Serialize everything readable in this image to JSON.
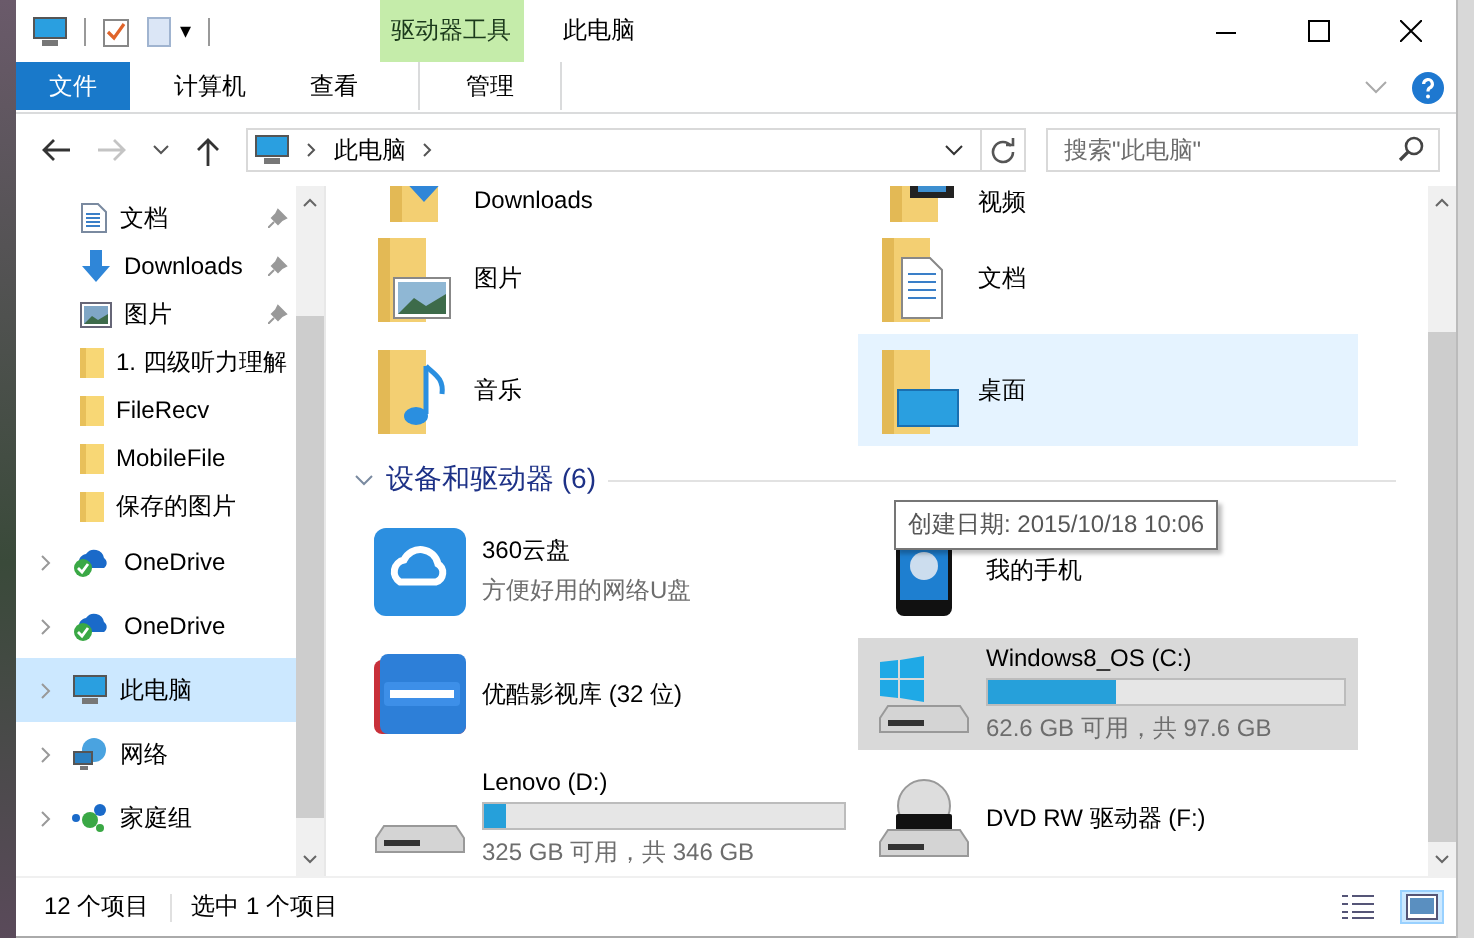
{
  "quick_access_toolbar": {
    "dropdown": "▾"
  },
  "window": {
    "title": "此电脑",
    "context_tab_group": "驱动器工具"
  },
  "ribbon_tabs": [
    {
      "label": "文件",
      "kind": "file",
      "selected": false
    },
    {
      "label": "计算机",
      "kind": "tab",
      "selected": false
    },
    {
      "label": "查看",
      "kind": "tab",
      "selected": false
    },
    {
      "label": "管理",
      "kind": "context",
      "selected": false
    }
  ],
  "address_bar": {
    "path": [
      "此电脑"
    ],
    "forward_disabled": true
  },
  "search": {
    "placeholder": "搜索\"此电脑\""
  },
  "navigation": {
    "items": [
      {
        "label": "文档",
        "pinned": true,
        "expandable": false,
        "selected": false
      },
      {
        "label": "Downloads",
        "pinned": true,
        "expandable": false,
        "selected": false
      },
      {
        "label": "图片",
        "pinned": true,
        "expandable": false,
        "selected": false
      },
      {
        "label": "1. 四级听力理解",
        "pinned": false,
        "expandable": false,
        "selected": false
      },
      {
        "label": "FileRecv",
        "pinned": false,
        "expandable": false,
        "selected": false
      },
      {
        "label": "MobileFile",
        "pinned": false,
        "expandable": false,
        "selected": false
      },
      {
        "label": "保存的图片",
        "pinned": false,
        "expandable": false,
        "selected": false
      },
      {
        "label": "OneDrive",
        "pinned": false,
        "expandable": true,
        "selected": false
      },
      {
        "label": "OneDrive",
        "pinned": false,
        "expandable": true,
        "selected": false
      },
      {
        "label": "此电脑",
        "pinned": false,
        "expandable": true,
        "selected": true
      },
      {
        "label": "网络",
        "pinned": false,
        "expandable": true,
        "selected": false
      },
      {
        "label": "家庭组",
        "pinned": false,
        "expandable": true,
        "selected": false
      }
    ]
  },
  "folders": [
    {
      "name": "Downloads",
      "hovered": false
    },
    {
      "name": "视频",
      "hovered": false
    },
    {
      "name": "图片",
      "hovered": false
    },
    {
      "name": "文档",
      "hovered": false
    },
    {
      "name": "音乐",
      "hovered": false
    },
    {
      "name": "桌面",
      "hovered": true
    }
  ],
  "devices_group": {
    "title": "设备和驱动器 (6)",
    "expanded": true,
    "items": [
      {
        "kind": "app",
        "name": "360云盘",
        "subtitle": "方便好用的网络U盘",
        "selected": false
      },
      {
        "kind": "device",
        "name": "我的手机",
        "selected": false
      },
      {
        "kind": "app",
        "name": "优酷影视库 (32 位)",
        "selected": false
      },
      {
        "kind": "drive",
        "name": "Windows8_OS (C:)",
        "level": 0.36,
        "space": "62.6 GB 可用，共 97.6 GB",
        "selected": true
      },
      {
        "kind": "drive",
        "name": "Lenovo (D:)",
        "level": 0.06,
        "space": "325 GB 可用，共 346 GB",
        "selected": false
      },
      {
        "kind": "optical",
        "name": "DVD RW 驱动器 (F:)",
        "selected": false
      }
    ]
  },
  "tooltip": {
    "text": "创建日期: 2015/10/18 10:06"
  },
  "status_bar": {
    "item_count": "12 个项目",
    "selection": "选中 1 个项目",
    "views": [
      {
        "kind": "details",
        "selected": false
      },
      {
        "kind": "large_icons",
        "selected": true
      }
    ]
  }
}
